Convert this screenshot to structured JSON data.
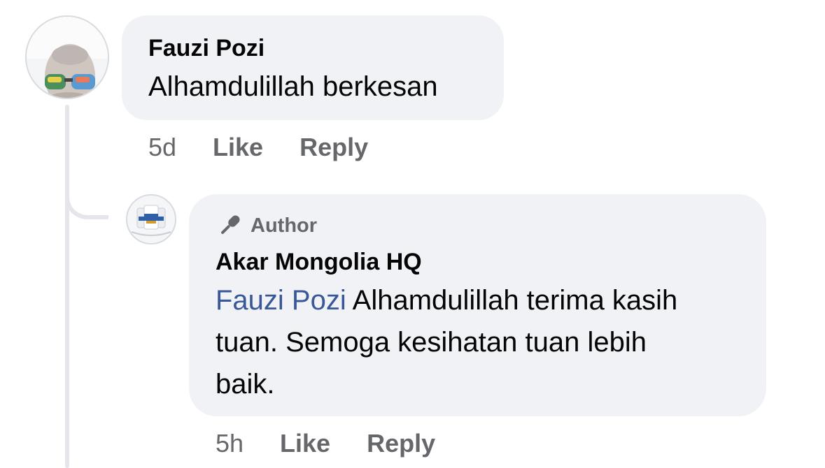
{
  "comment": {
    "author": "Fauzi Pozi",
    "text": "Alhamdulillah berkesan",
    "time": "5d",
    "like_label": "Like",
    "reply_label": "Reply"
  },
  "reply": {
    "badge": "Author",
    "author": "Akar Mongolia HQ",
    "mention": "Fauzi Pozi",
    "text_line1": " Alhamdulillah terima kasih",
    "text_line2": "tuan. Semoga kesihatan tuan lebih",
    "text_line3": "baik.",
    "time": "5h",
    "like_label": "Like",
    "reply_label": "Reply"
  },
  "colors": {
    "bubble": "#f0f2f5",
    "mention": "#385898",
    "meta": "#65676b",
    "thread_line": "#e4e6eb"
  },
  "icons": {
    "author_badge": "microphone-icon"
  }
}
